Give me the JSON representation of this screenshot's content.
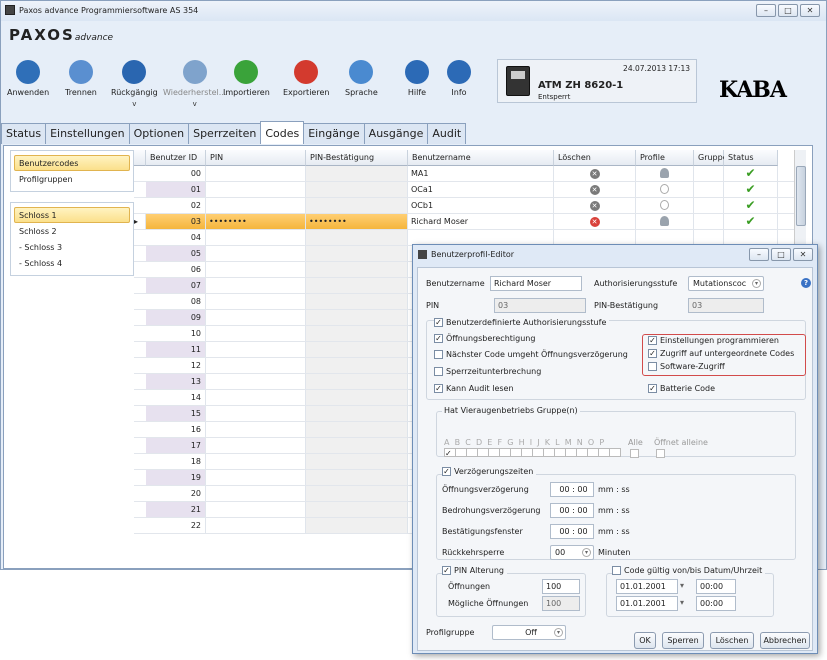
{
  "window": {
    "title": "Paxos advance Programmiersoftware AS 354",
    "logo_main": "PAXOS",
    "logo_sub": "advance",
    "btn_min": "–",
    "btn_max": "□",
    "btn_close": "✕"
  },
  "toolbar": [
    {
      "label": "Anwenden",
      "icon": "apply-icon",
      "color": "#2f6fb8"
    },
    {
      "label": "Trennen",
      "icon": "disconnect-icon",
      "color": "#5a8fd0"
    },
    {
      "label": "Rückgängig",
      "sub": "v",
      "icon": "undo-icon",
      "color": "#2a66b0"
    },
    {
      "label": "Wiederherstel...",
      "sub": "v",
      "icon": "redo-icon",
      "color": "#7fa3cc"
    },
    {
      "label": "Importieren",
      "icon": "import-icon",
      "color": "#3aa33a"
    },
    {
      "label": "Exportieren",
      "icon": "export-icon",
      "color": "#d33a2e"
    },
    {
      "label": "Sprache",
      "icon": "language-icon",
      "color": "#4a8ad0"
    },
    {
      "label": "Hilfe",
      "icon": "help-icon",
      "color": "#2c6ab6"
    },
    {
      "label": "Info",
      "icon": "info-icon",
      "color": "#2c6ab6"
    }
  ],
  "device": {
    "name": "ATM ZH 8620-1",
    "status": "Entsperrt",
    "datetime": "24.07.2013 17:13"
  },
  "brand": "KABA",
  "tabs": [
    "Status",
    "Einstellungen",
    "Optionen",
    "Sperrzeiten",
    "Codes",
    "Eingänge",
    "Ausgänge",
    "Audit"
  ],
  "active_tab": "Codes",
  "left_top": [
    "Benutzercodes",
    "Profilgruppen"
  ],
  "left_locks": [
    "Schloss 1",
    "Schloss 2",
    "- Schloss 3",
    "- Schloss 4"
  ],
  "grid": {
    "headers": [
      "Benutzer ID",
      "PIN",
      "PIN-Bestätigung",
      "Benutzername",
      "Löschen",
      "Profile",
      "Gruppe",
      "Status"
    ],
    "rows": [
      {
        "id": "00",
        "pin": "",
        "pinb": "",
        "name": "MA1",
        "del": true,
        "prof": "person",
        "status": "✔"
      },
      {
        "id": "01",
        "pin": "",
        "pinb": "",
        "name": "OCa1",
        "del": true,
        "prof": "plus",
        "status": "✔"
      },
      {
        "id": "02",
        "pin": "",
        "pinb": "",
        "name": "OCb1",
        "del": true,
        "prof": "plus",
        "status": "✔"
      },
      {
        "id": "03",
        "pin": "••••••••",
        "pinb": "••••••••",
        "name": "Richard Moser",
        "del": true,
        "prof": "person",
        "status": "✔"
      },
      {
        "id": "04"
      },
      {
        "id": "05"
      },
      {
        "id": "06"
      },
      {
        "id": "07"
      },
      {
        "id": "08"
      },
      {
        "id": "09"
      },
      {
        "id": "10"
      },
      {
        "id": "11"
      },
      {
        "id": "12"
      },
      {
        "id": "13"
      },
      {
        "id": "14"
      },
      {
        "id": "15"
      },
      {
        "id": "16"
      },
      {
        "id": "17"
      },
      {
        "id": "18"
      },
      {
        "id": "19"
      },
      {
        "id": "20"
      },
      {
        "id": "21"
      },
      {
        "id": "22"
      }
    ]
  },
  "dialog": {
    "title": "Benutzerprofil-Editor",
    "lbl_username": "Benutzername",
    "username": "Richard Moser",
    "lbl_auth": "Authorisierungsstufe",
    "auth": "Mutationscoc",
    "lbl_pin": "PIN",
    "pin": "03",
    "lbl_pinb": "PIN-Bestätigung",
    "pinb": "03",
    "grp_custom": "Benutzerdefinierte Authorisierungsstufe",
    "opt_open": "Öffnungsberechtigung",
    "opt_next": "Nächster Code umgeht Öffnungsverzögerung",
    "opt_interrupt": "Sperrzeitunterbrechung",
    "opt_audit": "Kann Audit lesen",
    "opt_settings": "Einstellungen programmieren",
    "opt_sub": "Zugriff auf untergeordnete Codes",
    "opt_sw": "Software-Zugriff",
    "opt_battery": "Batterie Code",
    "grp_four": "Hat Vieraugenbetriebs Gruppe(n)",
    "letters": "A B C D E F G H I J K L M N O P",
    "all": "Alle",
    "open_alone": "Öffnet alleine",
    "grp_delay": "Verzögerungszeiten",
    "d_open": "Öffnungsverzögerung",
    "d_open_v": "00 : 00",
    "d_threat": "Bedrohungsverzögerung",
    "d_threat_v": "00 : 00",
    "d_confirm": "Bestätigungsfenster",
    "d_confirm_v": "00 : 00",
    "d_return": "Rückkehrsperre",
    "d_return_v": "00",
    "unit_mmss": "mm : ss",
    "unit_min": "Minuten",
    "grp_pinage": "PIN Alterung",
    "openings": "Öffnungen",
    "openings_v": "100",
    "possible": "Mögliche Öffnungen",
    "possible_v": "100",
    "grp_valid": "Code gültig von/bis Datum/Uhrzeit",
    "date1": "01.01.2001",
    "time1": "00:00",
    "date2": "01.01.2001",
    "time2": "00:00",
    "lbl_profilegroup": "Profilgruppe",
    "profilegroup": "Off",
    "ok": "OK",
    "lock": "Sperren",
    "delete": "Löschen",
    "cancel": "Abbrechen"
  },
  "colors": {
    "accent": "#2f6fb8",
    "selection": "#f5b53c",
    "check": "#3a9d23",
    "highlight_box": "#d24b4b"
  }
}
